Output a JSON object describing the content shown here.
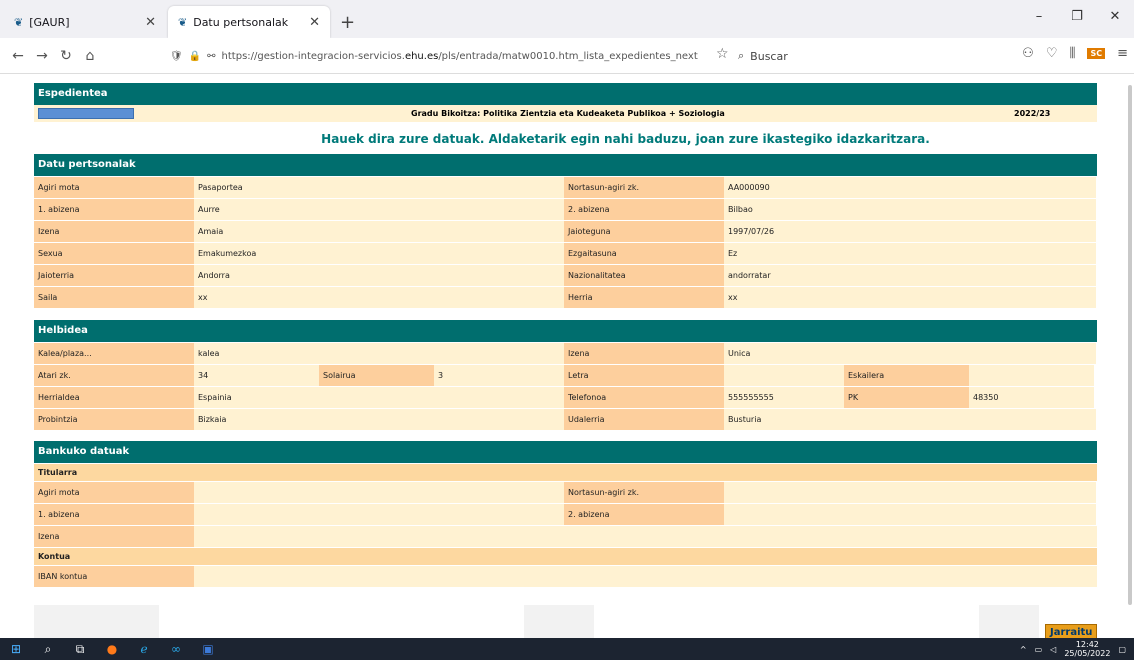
{
  "browser": {
    "tabs": [
      {
        "label": "[GAUR]"
      },
      {
        "label": "Datu pertsonalak"
      }
    ],
    "url_prefix": "https://gestion-integracion-servicios.",
    "url_domain": "ehu.es",
    "url_path": "/pls/entrada/matw0010.htm_lista_expedientes_next",
    "search_placeholder": "Buscar"
  },
  "expediente": {
    "header": "Espedientea",
    "degree": "Gradu Bikoitza: Politika Zientzia eta Kudeaketa Publikoa + Soziologia",
    "year": "2022/23",
    "notice": "Hauek dira zure datuak. Aldaketarik egin nahi baduzu, joan zure ikastegiko idazkaritzara."
  },
  "personal": {
    "header": "Datu pertsonalak",
    "rows": [
      {
        "l1": "Agiri mota",
        "v1": "Pasaportea",
        "l2": "Nortasun-agiri zk.",
        "v2": "AA000090"
      },
      {
        "l1": "1. abizena",
        "v1": "Aurre",
        "l2": "2. abizena",
        "v2": "Bilbao"
      },
      {
        "l1": "Izena",
        "v1": "Amaia",
        "l2": "Jaioteguna",
        "v2": "1997/07/26"
      },
      {
        "l1": "Sexua",
        "v1": "Emakumezkoa",
        "l2": "Ezgaitasuna",
        "v2": "Ez"
      },
      {
        "l1": "Jaioterria",
        "v1": "Andorra",
        "l2": "Nazionalitatea",
        "v2": "andorratar"
      },
      {
        "l1": "Saila",
        "v1": "xx",
        "l2": "Herria",
        "v2": "xx"
      }
    ]
  },
  "address": {
    "header": "Helbidea",
    "kalea_label": "Kalea/plaza...",
    "kalea_value": "kalea",
    "izena_label": "Izena",
    "izena_value": "Unica",
    "atari_label": "Atari zk.",
    "atari_value": "34",
    "solairua_label": "Solairua",
    "solairua_value": "3",
    "letra_label": "Letra",
    "letra_value": "",
    "eskailera_label": "Eskailera",
    "eskailera_value": "",
    "herrialdea_label": "Herrialdea",
    "herrialdea_value": "Espainia",
    "telefonoa_label": "Telefonoa",
    "telefonoa_value": "555555555",
    "pk_label": "PK",
    "pk_value": "48350",
    "probintzia_label": "Probintzia",
    "probintzia_value": "Bizkaia",
    "udalerria_label": "Udalerria",
    "udalerria_value": "Busturia"
  },
  "bank": {
    "header": "Bankuko datuak",
    "titularra": "Titularra",
    "agiri_label": "Agiri mota",
    "nortasun_label": "Nortasun-agiri zk.",
    "abizena1_label": "1. abizena",
    "abizena2_label": "2. abizena",
    "izena_label": "Izena",
    "kontua": "Kontua",
    "iban_label": "IBAN kontua"
  },
  "actions": {
    "continue": "Jarraitu"
  },
  "taskbar": {
    "time": "12:42",
    "date": "25/05/2022"
  }
}
